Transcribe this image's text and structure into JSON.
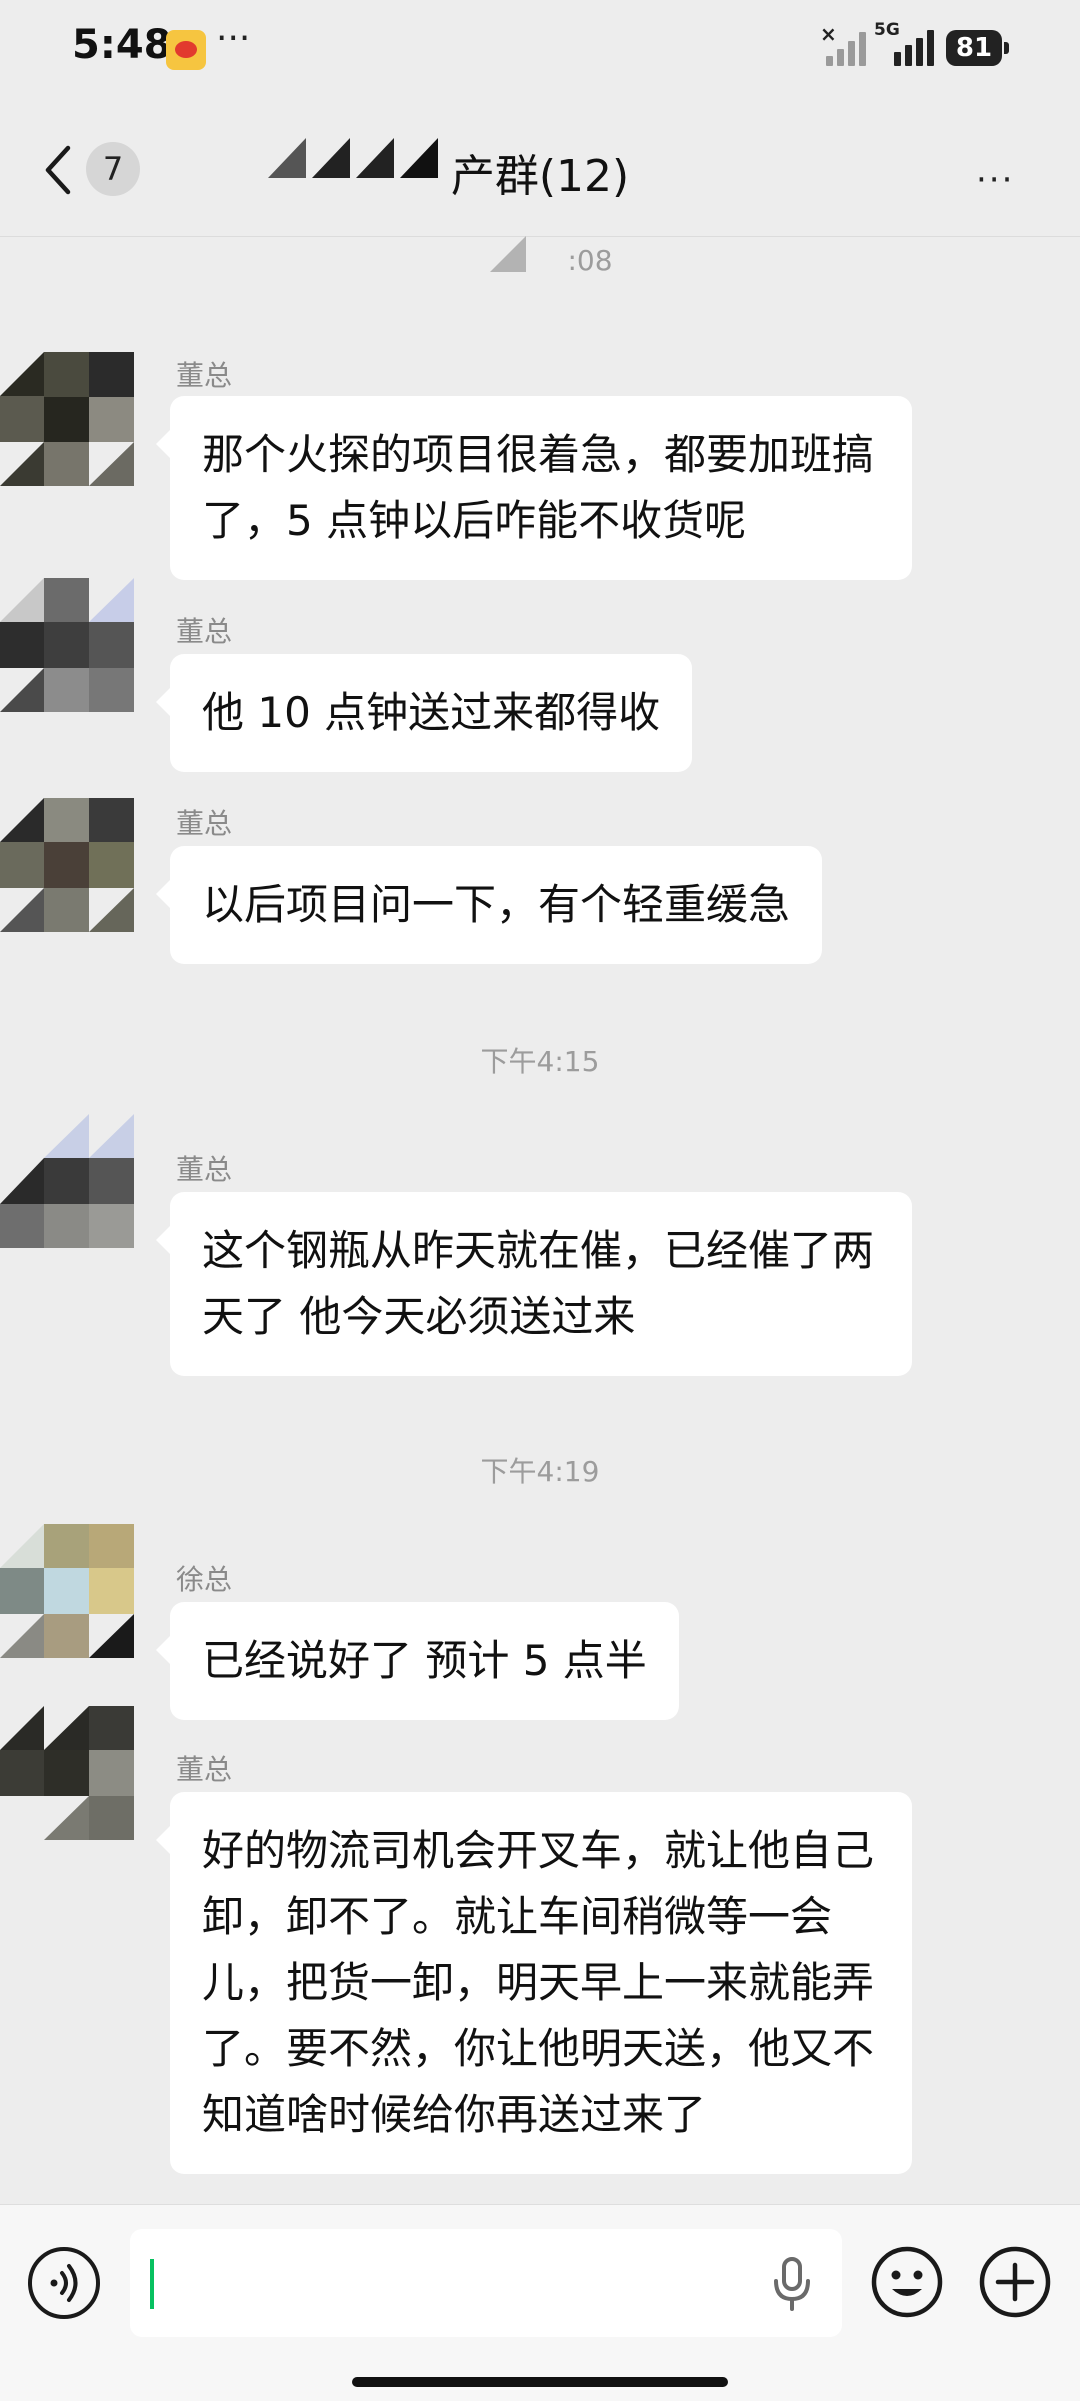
{
  "status_bar": {
    "time": "5:48",
    "dots": "···",
    "network": "5G",
    "battery": "81"
  },
  "nav": {
    "back_badge": "7",
    "title": "产群(12)",
    "more": "···"
  },
  "chat": {
    "top_timestamp": ":08",
    "messages": [
      {
        "sender": "董总",
        "text": "那个火探的项目很着急，都要加班搞了，5 点钟以后咋能不收货呢"
      },
      {
        "sender": "董总",
        "text": "他 10 点钟送过来都得收"
      },
      {
        "sender": "董总",
        "text": "以后项目问一下，有个轻重缓急"
      },
      {
        "sender": "董总",
        "text": "这个钢瓶从昨天就在催，已经催了两天了 他今天必须送过来"
      },
      {
        "sender": "徐总",
        "text": "已经说好了 预计 5 点半"
      },
      {
        "sender": "董总",
        "text": "好的物流司机会开叉车，就让他自己卸，卸不了。就让车间稍微等一会儿，把货一卸，明天早上一来就能弄了。要不然，你让他明天送，他又不知道啥时候给你再送过来了"
      }
    ],
    "timestamps": [
      "下午4:15",
      "下午4:19"
    ]
  },
  "input": {
    "value": ""
  },
  "icons": {
    "back": "chevron-left-icon",
    "more": "more-icon",
    "voice": "voice-icon",
    "mic": "microphone-icon",
    "emoji": "emoji-icon",
    "plus": "plus-icon"
  }
}
